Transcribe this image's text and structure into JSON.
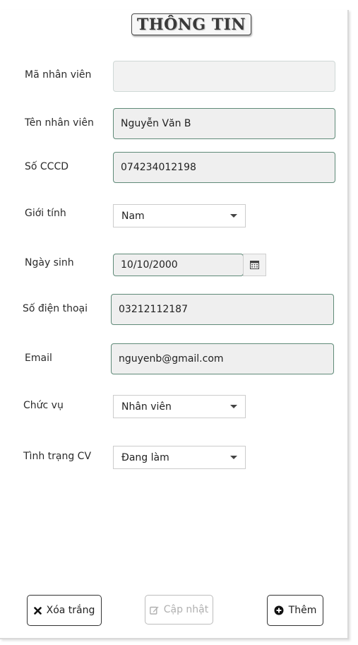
{
  "title": "THÔNG TIN",
  "fields": {
    "employee_id": {
      "label": "Mã nhân viên",
      "value": ""
    },
    "employee_name": {
      "label": "Tên nhân viên",
      "value": "Nguyễn Văn B"
    },
    "citizen_id": {
      "label": "Số CCCD",
      "value": "074234012198"
    },
    "gender": {
      "label": "Giới tính",
      "value": "Nam"
    },
    "birth_date": {
      "label": "Ngày sinh",
      "value": "10/10/2000"
    },
    "phone": {
      "label": "Số điện thoại",
      "value": "03212112187"
    },
    "email": {
      "label": "Email",
      "value": "nguyenb@gmail.com"
    },
    "position": {
      "label": "Chức vụ",
      "value": "Nhân viên"
    },
    "work_status": {
      "label": "Tình trạng CV",
      "value": "Đang làm"
    }
  },
  "buttons": {
    "clear": {
      "label": "Xóa trắng",
      "icon": "close-icon"
    },
    "update": {
      "label": "Cập nhật",
      "icon": "edit-icon",
      "enabled": false
    },
    "add": {
      "label": "Thêm",
      "icon": "plus-circle-icon"
    }
  },
  "colors": {
    "field_border": "#5f8a78",
    "field_bg": "#efefef",
    "disabled_text": "#b0b0b0"
  }
}
